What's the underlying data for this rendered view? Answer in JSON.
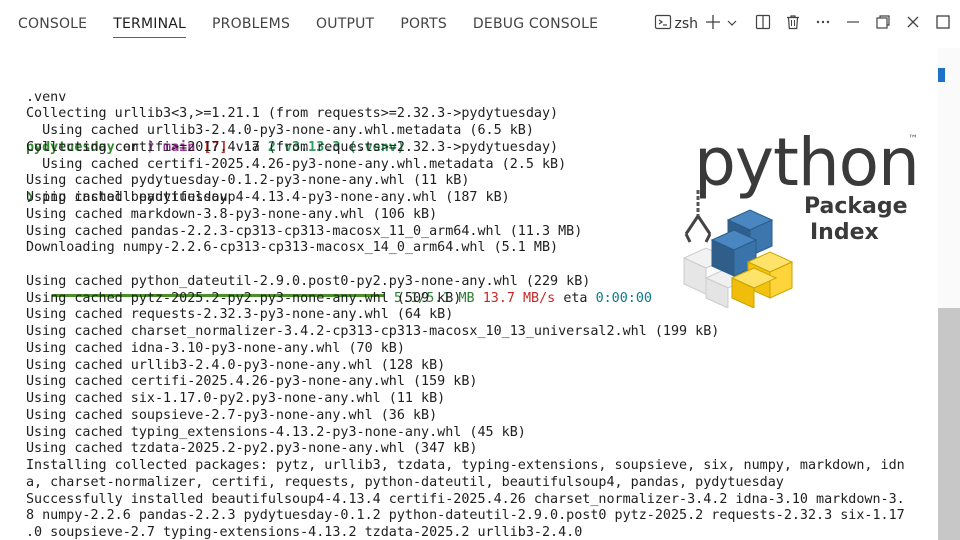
{
  "tabs": [
    {
      "label": "CONSOLE",
      "active": false
    },
    {
      "label": "TERMINAL",
      "active": true
    },
    {
      "label": "PROBLEMS",
      "active": false
    },
    {
      "label": "OUTPUT",
      "active": false
    },
    {
      "label": "PORTS",
      "active": false
    },
    {
      "label": "DEBUG CONSOLE",
      "active": false
    }
  ],
  "actions": {
    "shell": "zsh",
    "icons": [
      "terminal-icon",
      "plus-icon",
      "chevron-down-icon",
      "split-icon",
      "trash-icon",
      "ellipsis-icon",
      "minimize-icon",
      "restore-icon",
      "close-icon",
      "maximize-panel-icon"
    ]
  },
  "terminal": {
    "venv_line": ".venv",
    "prompt": {
      "dir": "pydytuesday",
      "on": " on ",
      "branch_icon": "ᚹ",
      "branch": " main",
      "status": " [?]",
      "via": " via ",
      "py_icon": "2",
      "py_version": " v3.13.3 (.venv)",
      "arrow": "❯",
      "command": " pip install pydytuesday"
    },
    "lines_before": [
      "Collecting urllib3<3,>=1.21.1 (from requests>=2.32.3->pydytuesday)",
      "  Using cached urllib3-2.4.0-py3-none-any.whl.metadata (6.5 kB)",
      "Collecting certifi>=2017.4.17 (from requests>=2.32.3->pydytuesday)",
      "  Using cached certifi-2025.4.26-py3-none-any.whl.metadata (2.5 kB)",
      "Using cached pydytuesday-0.1.2-py3-none-any.whl (11 kB)",
      "Using cached beautifulsoup4-4.13.4-py3-none-any.whl (187 kB)",
      "Using cached markdown-3.8-py3-none-any.whl (106 kB)",
      "Using cached pandas-2.2.3-cp313-cp313-macosx_11_0_arm64.whl (11.3 MB)",
      "Downloading numpy-2.2.6-cp313-cp313-macosx_14_0_arm64.whl (5.1 MB)"
    ],
    "progress": {
      "fraction": 1.0,
      "size": "5.1/5.1 MB",
      "speed": "13.7 MB/s",
      "eta_label": "eta",
      "eta": "0:00:00"
    },
    "lines_after": [
      "Using cached python_dateutil-2.9.0.post0-py2.py3-none-any.whl (229 kB)",
      "Using cached pytz-2025.2-py2.py3-none-any.whl (509 kB)",
      "Using cached requests-2.32.3-py3-none-any.whl (64 kB)",
      "Using cached charset_normalizer-3.4.2-cp313-cp313-macosx_10_13_universal2.whl (199 kB)",
      "Using cached idna-3.10-py3-none-any.whl (70 kB)",
      "Using cached urllib3-2.4.0-py3-none-any.whl (128 kB)",
      "Using cached certifi-2025.4.26-py3-none-any.whl (159 kB)",
      "Using cached six-1.17.0-py2.py3-none-any.whl (11 kB)",
      "Using cached soupsieve-2.7-py3-none-any.whl (36 kB)",
      "Using cached typing_extensions-4.13.2-py3-none-any.whl (45 kB)",
      "Using cached tzdata-2025.2-py2.py3-none-any.whl (347 kB)",
      "Installing collected packages: pytz, urllib3, tzdata, typing-extensions, soupsieve, six, numpy, markdown, idn",
      "a, charset-normalizer, certifi, requests, python-dateutil, beautifulsoup4, pandas, pydytuesday",
      "Successfully installed beautifulsoup4-4.13.4 certifi-2025.4.26 charset_normalizer-3.4.2 idna-3.10 markdown-3.",
      "8 numpy-2.2.6 pandas-2.2.3 pydytuesday-0.1.2 python-dateutil-2.9.0.post0 pytz-2025.2 requests-2.32.3 six-1.17",
      ".0 soupsieve-2.7 typing-extensions-4.13.2 tzdata-2025.2 urllib3-2.4.0"
    ]
  },
  "logo": {
    "word": "python",
    "tm": "™",
    "line1": "Package",
    "line2": "Index"
  },
  "colors": {
    "accent": "#1a73c9",
    "prompt_green": "#2e8b2e",
    "branch_magenta": "#a0309d",
    "progress_green": "#4a8f2a",
    "speed_red": "#c62828",
    "eta_cyan": "#0a7b8a",
    "python_blue": "#3572a5",
    "python_yellow": "#ffd43b"
  }
}
